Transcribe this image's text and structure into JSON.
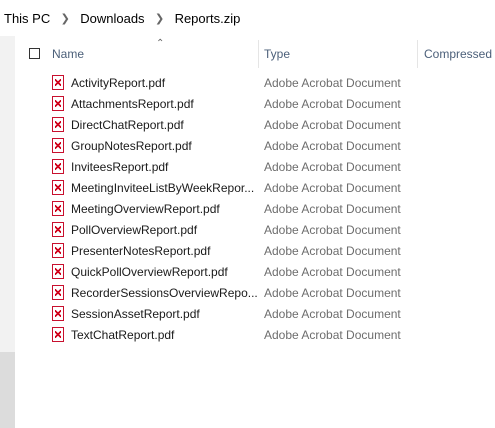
{
  "breadcrumb": [
    "This PC",
    "Downloads",
    "Reports.zip"
  ],
  "columns": {
    "name": "Name",
    "type": "Type",
    "compressed": "Compressed s"
  },
  "files": [
    {
      "name": "ActivityReport.pdf",
      "type": "Adobe Acrobat Document"
    },
    {
      "name": "AttachmentsReport.pdf",
      "type": "Adobe Acrobat Document"
    },
    {
      "name": "DirectChatReport.pdf",
      "type": "Adobe Acrobat Document"
    },
    {
      "name": "GroupNotesReport.pdf",
      "type": "Adobe Acrobat Document"
    },
    {
      "name": "InviteesReport.pdf",
      "type": "Adobe Acrobat Document"
    },
    {
      "name": "MeetingInviteeListByWeekRepor...",
      "type": "Adobe Acrobat Document"
    },
    {
      "name": "MeetingOverviewReport.pdf",
      "type": "Adobe Acrobat Document"
    },
    {
      "name": "PollOverviewReport.pdf",
      "type": "Adobe Acrobat Document"
    },
    {
      "name": "PresenterNotesReport.pdf",
      "type": "Adobe Acrobat Document"
    },
    {
      "name": "QuickPollOverviewReport.pdf",
      "type": "Adobe Acrobat Document"
    },
    {
      "name": "RecorderSessionsOverviewRepo...",
      "type": "Adobe Acrobat Document"
    },
    {
      "name": "SessionAssetReport.pdf",
      "type": "Adobe Acrobat Document"
    },
    {
      "name": "TextChatReport.pdf",
      "type": "Adobe Acrobat Document"
    }
  ],
  "icons": {
    "file": "pdf-file-icon",
    "separator": "chevron-right-icon",
    "sort": "sort-ascending-icon"
  },
  "colors": {
    "pdf_icon": "#d0021b",
    "header_text": "#4c607a",
    "type_text": "#6d6d6d"
  }
}
